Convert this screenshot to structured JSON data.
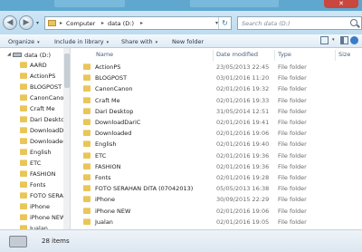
{
  "window": {
    "close_glyph": "✕"
  },
  "address": {
    "back_glyph": "◀",
    "forward_glyph": "▶",
    "crumbs": [
      "Computer",
      "data (D:)"
    ],
    "separator": "▸",
    "dropdown_glyph": "▾",
    "refresh_glyph": "↻"
  },
  "search": {
    "placeholder": "Search data (D:)"
  },
  "toolbar": {
    "organize": "Organize",
    "include_in_library": "Include in library",
    "share_with": "Share with",
    "new_folder": "New folder",
    "arrow": "▾"
  },
  "nav": {
    "drive_arrow": "◢",
    "drive": "data (D:)",
    "folders": [
      "AARD",
      "ActionPS",
      "BLOGPOST",
      "CanonCanon",
      "Craft Me",
      "Dari Desktop",
      "DownloadDa",
      "Downloaded",
      "English",
      "ETC",
      "FASHION",
      "Fonts",
      "FOTO SERAH",
      "iPhone",
      "iPhone NEW",
      "Jualan"
    ]
  },
  "columns": {
    "name": "Name",
    "date_modified": "Date modified",
    "type": "Type",
    "size": "Size"
  },
  "files": [
    {
      "name": "ActionPS",
      "date": "23/05/2013 22:45",
      "type": "File folder"
    },
    {
      "name": "BLOGPOST",
      "date": "03/01/2016 11:20",
      "type": "File folder"
    },
    {
      "name": "CanonCanon",
      "date": "02/01/2016 19:32",
      "type": "File folder"
    },
    {
      "name": "Craft Me",
      "date": "02/01/2016 19:33",
      "type": "File folder"
    },
    {
      "name": "Dari Desktop",
      "date": "31/05/2014 12:51",
      "type": "File folder"
    },
    {
      "name": "DownloadDariC",
      "date": "02/01/2016 19:41",
      "type": "File folder"
    },
    {
      "name": "Downloaded",
      "date": "02/01/2016 19:06",
      "type": "File folder"
    },
    {
      "name": "English",
      "date": "02/01/2016 19:40",
      "type": "File folder"
    },
    {
      "name": "ETC",
      "date": "02/01/2016 19:36",
      "type": "File folder"
    },
    {
      "name": "FASHION",
      "date": "02/01/2016 19:36",
      "type": "File folder"
    },
    {
      "name": "Fonts",
      "date": "02/01/2016 19:28",
      "type": "File folder"
    },
    {
      "name": "FOTO SERAHAN DITA (07042013)",
      "date": "05/05/2013 16:38",
      "type": "File folder"
    },
    {
      "name": "iPhone",
      "date": "30/09/2015 22:29",
      "type": "File folder"
    },
    {
      "name": "iPhone NEW",
      "date": "02/01/2016 19:06",
      "type": "File folder"
    },
    {
      "name": "Jualan",
      "date": "02/01/2016 19:05",
      "type": "File folder"
    }
  ],
  "status": {
    "item_count": "28 items"
  },
  "colors": {
    "titlebar": "#5fa7cf",
    "folder": "#e9c65a",
    "close": "#c9473f"
  }
}
